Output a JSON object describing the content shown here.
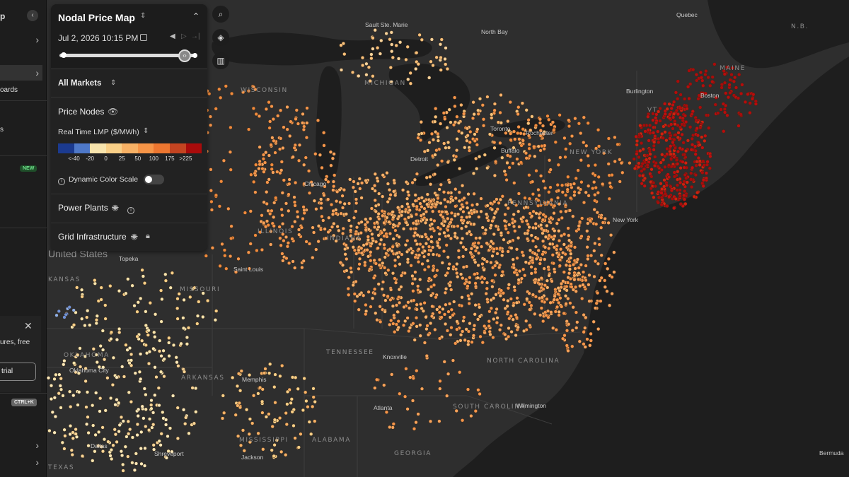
{
  "panel": {
    "title": "Nodal Price Map",
    "date_label": "Jul 2, 2026 10:15 PM",
    "market_label": "All Markets",
    "price_nodes_label": "Price Nodes",
    "metric_label": "Real Time LMP ($/MWh)",
    "legend_colors": [
      "#1b3a8f",
      "#4e78c8",
      "#f7e4ad",
      "#f8cf87",
      "#f7b165",
      "#f59447",
      "#ec7630",
      "#c44421",
      "#a90b0b"
    ],
    "legend_ticks": [
      "<-40",
      "-20",
      "0",
      "25",
      "50",
      "100",
      "175",
      ">225"
    ],
    "dynamic_color_label": "Dynamic Color Scale",
    "dynamic_color_enabled": false,
    "power_plants_label": "Power Plants",
    "grid_infrastructure_label": "Grid Infrastructure"
  },
  "sidebar": {
    "fragments": [
      "p",
      "oards",
      "s",
      "ures, free",
      "trial"
    ],
    "new_badge": "NEW",
    "shortcut": "CTRL+K"
  },
  "icons": {
    "tools": [
      "search-icon",
      "layers-icon",
      "columns-icon"
    ]
  },
  "map": {
    "region_labels": [
      "WISCONSIN",
      "MICHIGAN",
      "ILLINOIS",
      "INDIANA",
      "MISSOURI",
      "KANSAS",
      "OKLAHOMA",
      "ARKANSAS",
      "TENNESSEE",
      "MISSISSIPPI",
      "ALABAMA",
      "GEORGIA",
      "SOUTH CAROLINA",
      "NORTH CAROLINA",
      "NEW YORK",
      "MAINE",
      "TEXAS",
      "PENNSYLVANIA",
      "VT",
      "N.B.",
      "Bermuda"
    ],
    "country_label": "United States",
    "city_labels": [
      "Quebec",
      "Sault Ste. Marie",
      "North Bay",
      "Toronto",
      "Rochester",
      "Buffalo",
      "Detroit",
      "Chicago",
      "Saint Louis",
      "Topeka",
      "Oklahoma City",
      "Dallas",
      "Shreveport",
      "Jackson",
      "Memphis",
      "Knoxville",
      "Atlanta",
      "Wilmington",
      "Boston",
      "New York",
      "Burlington"
    ]
  }
}
